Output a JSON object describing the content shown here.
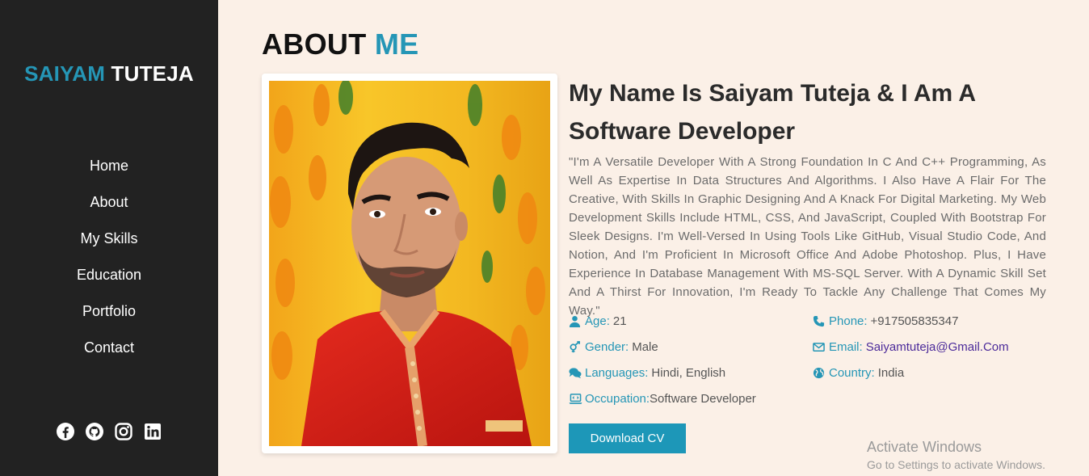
{
  "brand": {
    "first": "SAIYAM",
    "last": "TUTEJA"
  },
  "nav": {
    "items": [
      {
        "label": "Home"
      },
      {
        "label": "About"
      },
      {
        "label": "My Skills"
      },
      {
        "label": "Education"
      },
      {
        "label": "Portfolio"
      },
      {
        "label": "Contact"
      }
    ]
  },
  "socials": [
    "facebook-icon",
    "github-icon",
    "instagram-icon",
    "linkedin-icon"
  ],
  "about": {
    "title_main": "ABOUT",
    "title_accent": "ME",
    "headline": "My Name Is Saiyam Tuteja & I Am A Software Developer",
    "bio": "\"I'm A Versatile Developer With A Strong Foundation In C And C++ Programming, As Well As Expertise In Data Structures And Algorithms. I Also Have A Flair For The Creative, With Skills In Graphic Designing And A Knack For Digital Marketing. My Web Development Skills Include HTML, CSS, And JavaScript, Coupled With Bootstrap For Sleek Designs. I'm Well-Versed In Using Tools Like GitHub, Visual Studio Code, And Notion, And I'm Proficient In Microsoft Office And Adobe Photoshop. Plus, I Have Experience In Database Management With MS-SQL Server. With A Dynamic Skill Set And A Thirst For Innovation, I'm Ready To Tackle Any Challenge That Comes My Way.\"",
    "info": {
      "age": {
        "label": "Age:",
        "value": "21"
      },
      "phone": {
        "label": "Phone:",
        "value": "+917505835347"
      },
      "gender": {
        "label": "Gender:",
        "value": "Male"
      },
      "email": {
        "label": "Email:",
        "value": "Saiyamtuteja@Gmail.Com"
      },
      "languages": {
        "label": "Languages:",
        "value": "Hindi, English"
      },
      "country": {
        "label": "Country:",
        "value": "India"
      },
      "occupation": {
        "label": "Occupation:",
        "value": "Software Developer"
      }
    },
    "download_label": "Download CV"
  },
  "watermark": {
    "line1": "Activate Windows",
    "line2": "Go to Settings to activate Windows."
  },
  "colors": {
    "accent": "#2596b6",
    "sidebar": "#222222",
    "background": "#fbf0e7",
    "button": "#1d97b8"
  }
}
